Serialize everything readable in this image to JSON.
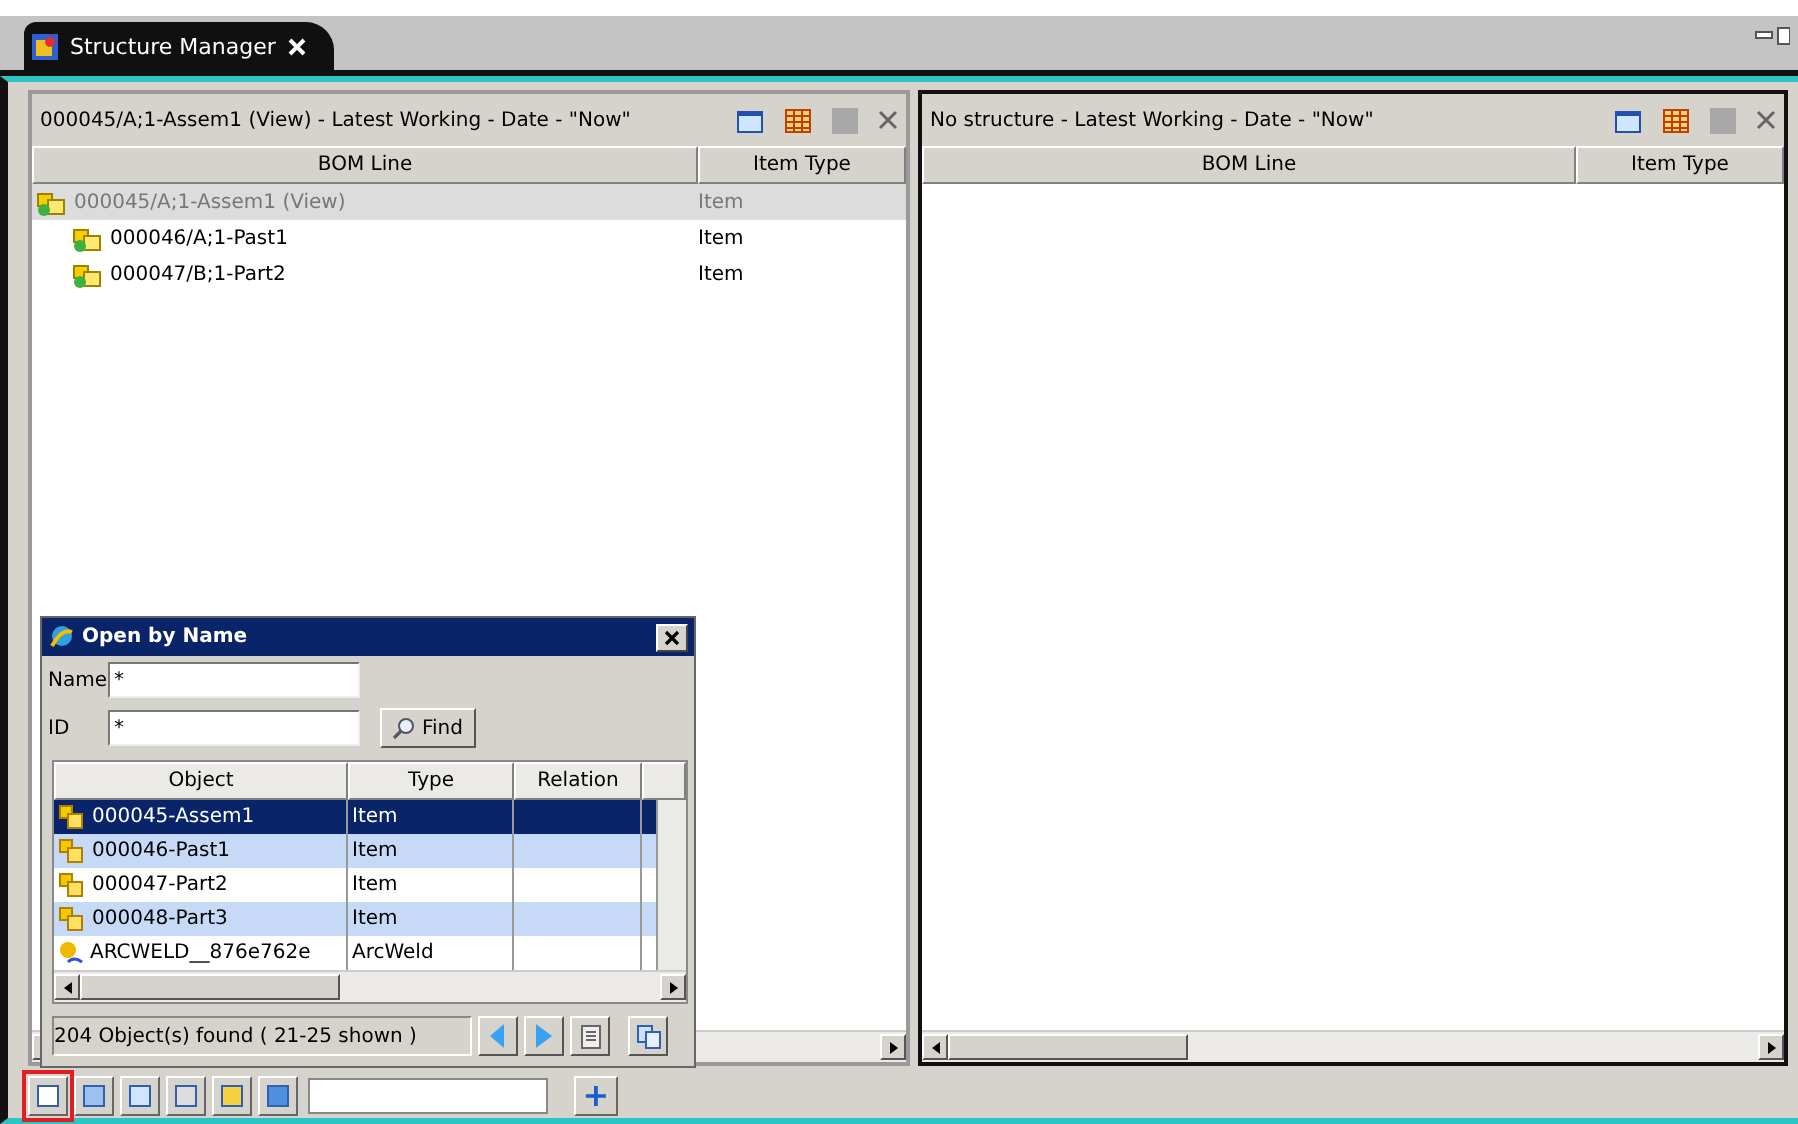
{
  "tab": {
    "title": "Structure Manager",
    "selected": true
  },
  "panes": [
    {
      "title": "000045/A;1-Assem1 (View) - Latest Working - Date - \"Now\"",
      "active": false,
      "columns": [
        "BOM Line",
        "Item Type"
      ],
      "rows": [
        {
          "label": "000045/A;1-Assem1 (View)",
          "type": "Item",
          "selected": true,
          "children": [
            {
              "label": "000046/A;1-Past1",
              "type": "Item",
              "selected": false
            },
            {
              "label": "000047/B;1-Part2",
              "type": "Item",
              "selected": false
            }
          ]
        }
      ]
    },
    {
      "title": "No structure - Latest Working - Date - \"Now\"",
      "active": true,
      "columns": [
        "BOM Line",
        "Item Type"
      ]
    }
  ],
  "dialog": {
    "title": "Open by Name",
    "fields": [
      {
        "label": "Name",
        "value": "*"
      },
      {
        "label": "ID",
        "value": "*"
      }
    ],
    "find_button": "Find",
    "columns": [
      "Object",
      "Type",
      "Relation"
    ],
    "rows": [
      {
        "object": "000045-Assem1",
        "type": "Item",
        "kind": "item",
        "selected": true
      },
      {
        "object": "000046-Past1",
        "type": "Item",
        "kind": "item",
        "selected": false
      },
      {
        "object": "000047-Part2",
        "type": "Item",
        "kind": "item",
        "selected": false
      },
      {
        "object": "000048-Part3",
        "type": "Item",
        "kind": "item",
        "selected": false
      },
      {
        "object": "ARCWELD__876e762e",
        "type": "ArcWeld",
        "kind": "weld",
        "selected": false
      }
    ],
    "status": "204 Object(s) found ( 21-25  shown )"
  },
  "toolbar": {
    "buttons": [
      {
        "highlighted": true
      },
      {
        "highlighted": false
      },
      {
        "highlighted": false
      },
      {
        "highlighted": false
      },
      {
        "highlighted": false
      },
      {
        "highlighted": false
      }
    ],
    "add_button": "+"
  }
}
